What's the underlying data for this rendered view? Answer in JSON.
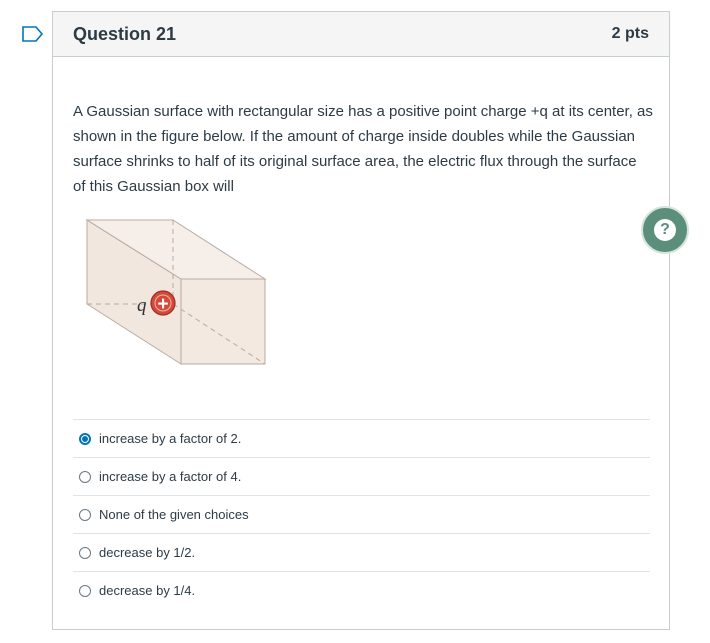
{
  "question": {
    "title": "Question 21",
    "points": "2 pts",
    "text": "A Gaussian surface with rectangular size has a positive point charge +q at its center, as shown in the figure below. If the amount of charge inside doubles while the Gaussian surface shrinks to half of its original surface area, the electric flux through the surface of this Gaussian box will"
  },
  "figure": {
    "charge_label": "q",
    "charge_sign": "+"
  },
  "answers": [
    {
      "label": "increase by a factor of 2.",
      "selected": true
    },
    {
      "label": "increase by a factor of 4.",
      "selected": false
    },
    {
      "label": "None of the given choices",
      "selected": false
    },
    {
      "label": "decrease by 1/2.",
      "selected": false
    },
    {
      "label": "decrease by 1/4.",
      "selected": false
    }
  ],
  "help": {
    "icon": "?"
  },
  "colors": {
    "accent": "#0374b5",
    "help_bg": "#5b8f7c",
    "charge": "#c0392b"
  }
}
